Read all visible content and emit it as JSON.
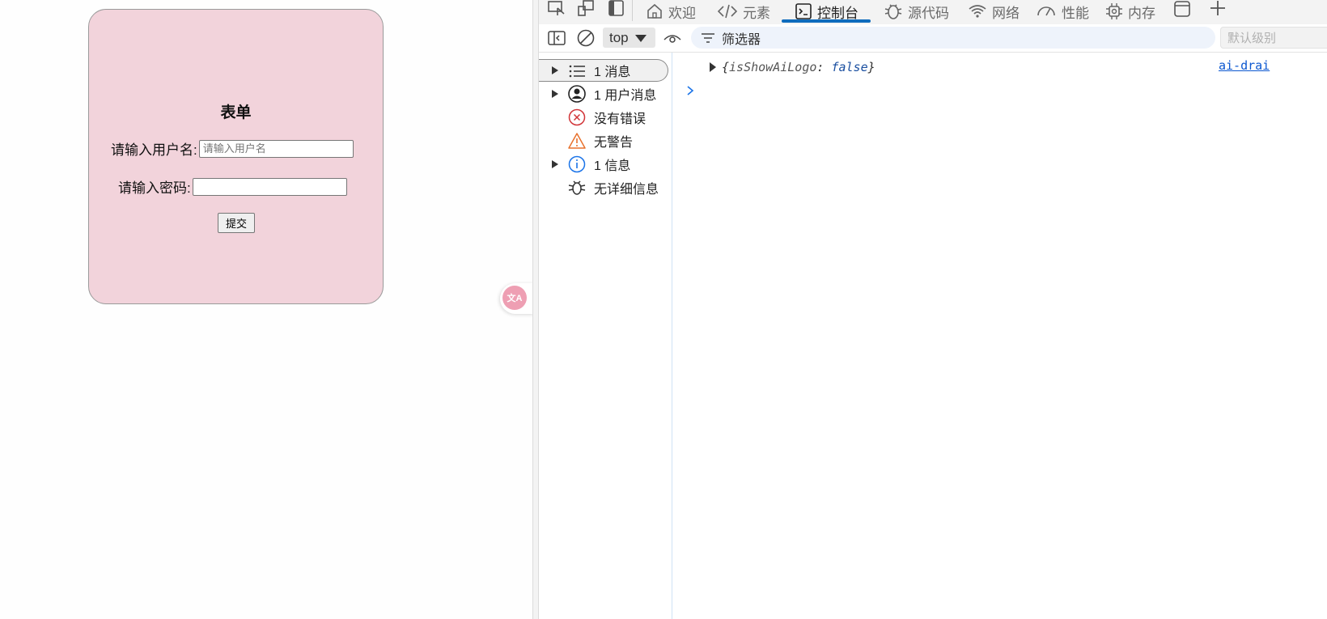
{
  "form": {
    "title": "表单",
    "username_label": "请输入用户名:",
    "username_placeholder": "请输入用户名",
    "password_label": "请输入密码:",
    "submit_label": "提交"
  },
  "translate_widget": {
    "icon": "translate-icon",
    "text": "文A"
  },
  "devtools": {
    "tabs": [
      {
        "label": "欢迎",
        "icon": "home-icon"
      },
      {
        "label": "元素",
        "icon": "code-icon"
      },
      {
        "label": "控制台",
        "icon": "console-icon",
        "active": true
      },
      {
        "label": "源代码",
        "icon": "bug-icon"
      },
      {
        "label": "网络",
        "icon": "wifi-icon"
      },
      {
        "label": "性能",
        "icon": "gauge-icon"
      },
      {
        "label": "内存",
        "icon": "chip-icon"
      }
    ],
    "toolbar": {
      "context": "top",
      "filter_placeholder": "筛选器",
      "levels": "默认级别"
    },
    "sidebar": [
      {
        "label": "1 消息",
        "icon": "list-icon",
        "expandable": true,
        "selected": true
      },
      {
        "label": "1 用户消息",
        "icon": "user-icon",
        "expandable": true
      },
      {
        "label": "没有错误",
        "icon": "error-icon",
        "expandable": false
      },
      {
        "label": "无警告",
        "icon": "warning-icon",
        "expandable": false
      },
      {
        "label": "1 信息",
        "icon": "info-icon",
        "expandable": true
      },
      {
        "label": "无详细信息",
        "icon": "bug-icon",
        "expandable": false
      }
    ],
    "log": {
      "open": "{",
      "key": "isShowAiLogo",
      "sep": ":",
      "value": "false",
      "close": "}",
      "source": "ai-drai"
    },
    "colors": {
      "accent": "#0f6cbd",
      "error": "#d13438",
      "warning": "#e8712d",
      "info": "#1a73e8",
      "form_bg": "#f2d3db"
    }
  }
}
